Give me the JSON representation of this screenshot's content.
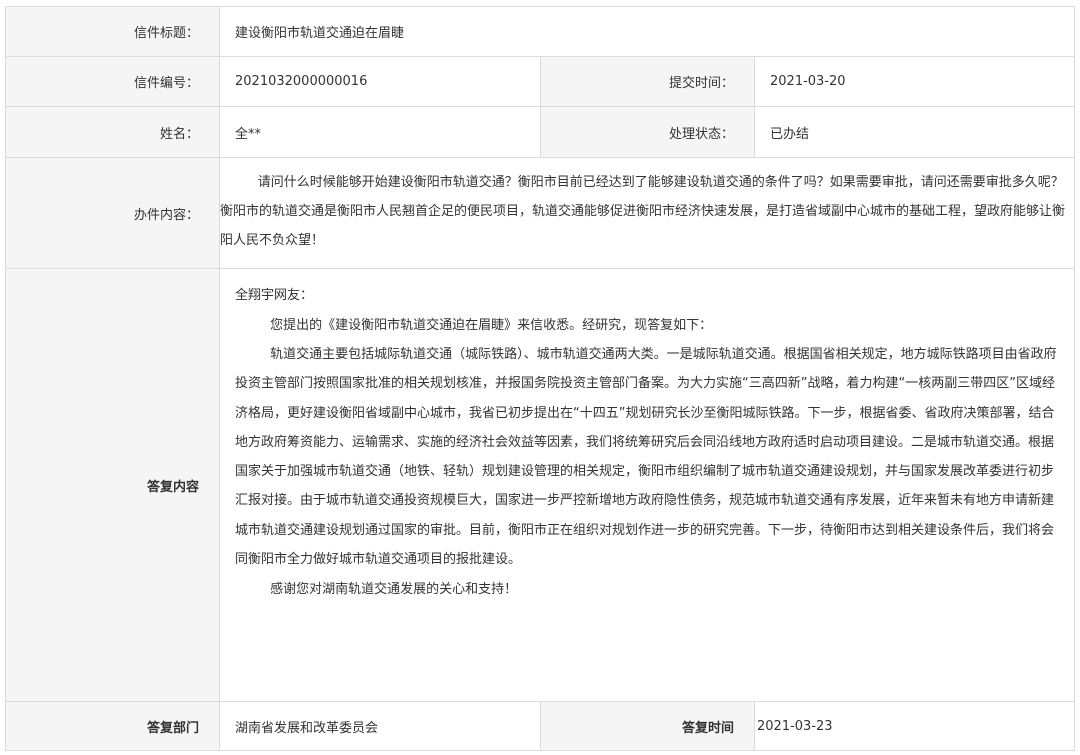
{
  "letter": {
    "title_label": "信件标题：",
    "title_value": "建设衡阳市轨道交通迫在眉睫",
    "number_label": "信件编号：",
    "number_value": "2021032000000016",
    "submit_time_label": "提交时间：",
    "submit_time_value": "2021-03-20",
    "name_label": "姓名：",
    "name_value": "全**",
    "status_label": "处理状态：",
    "status_value": "已办结",
    "content_label": "办件内容：",
    "content_value": "请问什么时候能够开始建设衡阳市轨道交通？衡阳市目前已经达到了能够建设轨道交通的条件了吗？如果需要审批，请问还需要审批多久呢？衡阳市的轨道交通是衡阳市人民翘首企足的便民项目，轨道交通能够促进衡阳市经济快速发展，是打造省域副中心城市的基础工程，望政府能够让衡阳人民不负众望！"
  },
  "reply": {
    "label": "答复内容",
    "greeting": "全翔宇网友：",
    "p1": "您提出的《建设衡阳市轨道交通迫在眉睫》来信收悉。经研究，现答复如下：",
    "p2": "轨道交通主要包括城际轨道交通（城际铁路）、城市轨道交通两大类。一是城际轨道交通。根据国省相关规定，地方城际铁路项目由省政府投资主管部门按照国家批准的相关规划核准，并报国务院投资主管部门备案。为大力实施“三高四新”战略，着力构建“一核两副三带四区”区域经济格局，更好建设衡阳省域副中心城市，我省已初步提出在“十四五”规划研究长沙至衡阳城际铁路。下一步，根据省委、省政府决策部署，结合地方政府筹资能力、运输需求、实施的经济社会效益等因素，我们将统筹研究后会同沿线地方政府适时启动项目建设。二是城市轨道交通。根据国家关于加强城市轨道交通（地铁、轻轨）规划建设管理的相关规定，衡阳市组织编制了城市轨道交通建设规划，并与国家发展改革委进行初步汇报对接。由于城市轨道交通投资规模巨大，国家进一步严控新增地方政府隐性债务，规范城市轨道交通有序发展，近年来暂未有地方申请新建城市轨道交通建设规划通过国家的审批。目前，衡阳市正在组织对规划作进一步的研究完善。下一步，待衡阳市达到相关建设条件后，我们将会同衡阳市全力做好城市轨道交通项目的报批建设。",
    "p3": "感谢您对湖南轨道交通发展的关心和支持！",
    "dept_label": "答复部门",
    "dept_value": "湖南省发展和改革委员会",
    "time_label": "答复时间",
    "time_value": "2021-03-23"
  }
}
